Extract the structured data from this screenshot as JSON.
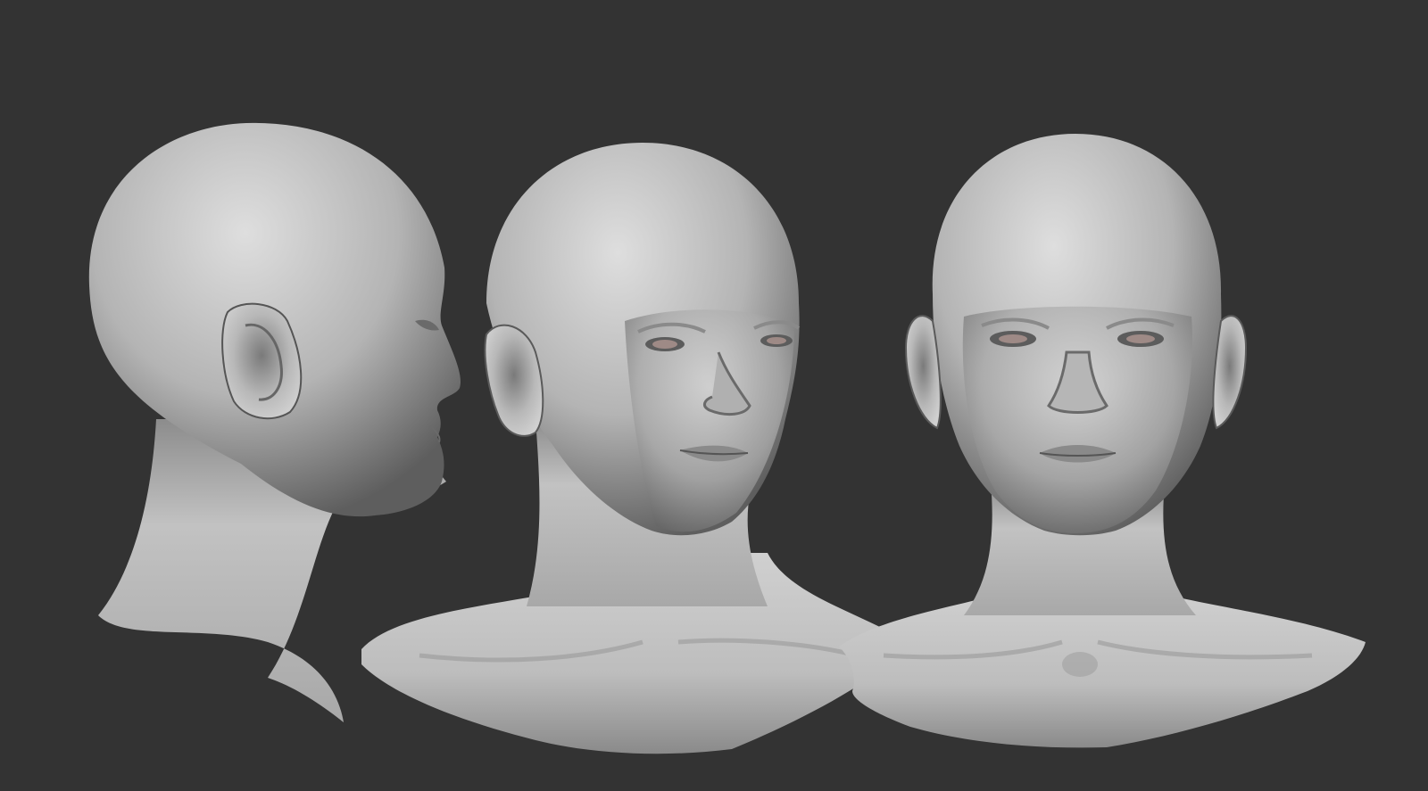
{
  "scene": {
    "background_color": "#333333",
    "clay_light": "#d4d4d4",
    "clay_mid": "#9c9c9c",
    "clay_dark": "#4f4f4f",
    "eye_tint": "#c9a9a2",
    "views": [
      {
        "id": "profile-view",
        "description": "side profile",
        "ears": [
          "left"
        ],
        "visible_eyes": 1
      },
      {
        "id": "three-quarter-view",
        "description": "three-quarter",
        "ears": [
          "right"
        ],
        "visible_eyes": 2
      },
      {
        "id": "front-view",
        "description": "front",
        "ears": [
          "left",
          "right"
        ],
        "visible_eyes": 2
      }
    ]
  }
}
